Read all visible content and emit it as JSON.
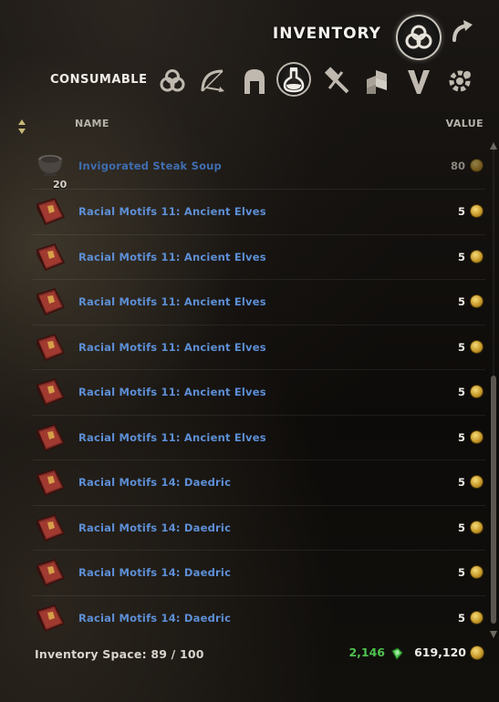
{
  "window": {
    "title": "INVENTORY",
    "main_category_icon": "all-items-triquetra-icon",
    "back_icon": "curved-arrow-icon"
  },
  "filter": {
    "label": "CONSUMABLE",
    "categories": [
      {
        "icon": "all-triquetra-icon",
        "active": false
      },
      {
        "icon": "bow-icon",
        "active": false
      },
      {
        "icon": "helmet-icon",
        "active": false
      },
      {
        "icon": "potion-flask-icon",
        "active": true
      },
      {
        "icon": "hammer-icon",
        "active": false
      },
      {
        "icon": "crates-icon",
        "active": false
      },
      {
        "icon": "furnishing-icon",
        "active": false
      },
      {
        "icon": "gear-junk-icon",
        "active": false
      }
    ]
  },
  "columns": {
    "name": "NAME",
    "value": "VALUE"
  },
  "items": [
    {
      "name": "Invigorated Steak Soup",
      "value": "80",
      "qty": "20",
      "icon": "soup-bowl-icon",
      "dim": true
    },
    {
      "name": "Racial Motifs 11: Ancient Elves",
      "value": "5",
      "icon": "book-icon"
    },
    {
      "name": "Racial Motifs 11: Ancient Elves",
      "value": "5",
      "icon": "book-icon"
    },
    {
      "name": "Racial Motifs 11: Ancient Elves",
      "value": "5",
      "icon": "book-icon"
    },
    {
      "name": "Racial Motifs 11: Ancient Elves",
      "value": "5",
      "icon": "book-icon"
    },
    {
      "name": "Racial Motifs 11: Ancient Elves",
      "value": "5",
      "icon": "book-icon"
    },
    {
      "name": "Racial Motifs 11: Ancient Elves",
      "value": "5",
      "icon": "book-icon"
    },
    {
      "name": "Racial Motifs 14: Daedric",
      "value": "5",
      "icon": "book-icon"
    },
    {
      "name": "Racial Motifs 14: Daedric",
      "value": "5",
      "icon": "book-icon"
    },
    {
      "name": "Racial Motifs 14: Daedric",
      "value": "5",
      "icon": "book-icon"
    },
    {
      "name": "Racial Motifs 14: Daedric",
      "value": "5",
      "icon": "book-icon"
    }
  ],
  "footer": {
    "space_label": "Inventory Space: 89 / 100",
    "crowns": "2,146",
    "gold": "619,120"
  },
  "colors": {
    "item_name": "#5d8fd6",
    "crowns": "#4fc24f",
    "gold_coin": "#d4a838"
  }
}
